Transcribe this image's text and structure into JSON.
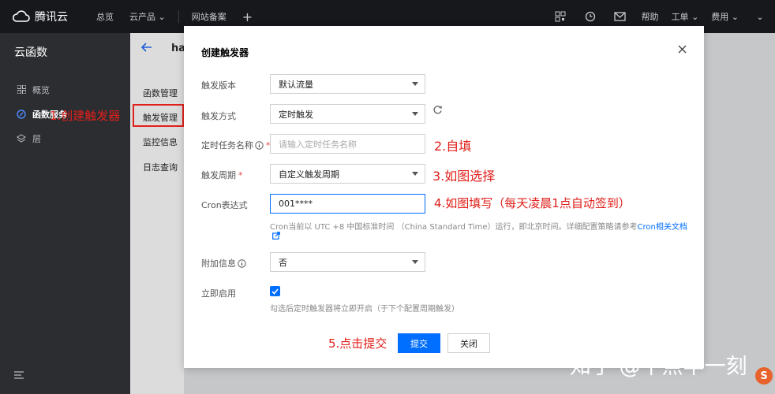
{
  "topbar": {
    "brand": "腾讯云",
    "nav": [
      "总览",
      "云产品",
      "网站备案"
    ],
    "right": [
      "帮助",
      "工单",
      "费用"
    ]
  },
  "sidebar": {
    "title": "云函数",
    "items": [
      {
        "label": "概览",
        "icon": "grid-icon"
      },
      {
        "label": "函数服务",
        "icon": "function-icon"
      },
      {
        "label": "层",
        "icon": "layer-icon"
      }
    ]
  },
  "subside": {
    "page_title_partial": "ha",
    "items": [
      "函数管理",
      "触发管理",
      "监控信息",
      "日志查询"
    ]
  },
  "dialog": {
    "title": "创建触发器",
    "fields": {
      "version": {
        "label": "触发版本",
        "value": "默认流量"
      },
      "method": {
        "label": "触发方式",
        "value": "定时触发"
      },
      "task_name": {
        "label": "定时任务名称",
        "placeholder": "请输入定时任务名称",
        "required": "*"
      },
      "period": {
        "label": "触发周期",
        "value": "自定义触发周期",
        "required": "*"
      },
      "cron": {
        "label": "Cron表达式",
        "value": "001****"
      },
      "cron_hint": {
        "text": "Cron当前以 UTC +8 中国标准时间 （China Standard Time）运行，即北京时间。详细配置策略请参考",
        "link": "Cron相关文档"
      },
      "extra": {
        "label": "附加信息",
        "value": "否"
      },
      "enable": {
        "label": "立即启用",
        "hint": "勾选后定时触发器将立即开启（于下个配置周期触发）"
      }
    },
    "submit_label": "提交",
    "close_label": "关闭"
  },
  "annotations": {
    "a1": "1.创建触发器",
    "a2": "2.自填",
    "a3": "3.如图选择",
    "a4": "4.如图填写（每天凌晨1点自动签到）",
    "a5": "5.点击提交"
  },
  "watermark": "知乎 @十点半一刻",
  "watermark_logo": "S",
  "colors": {
    "accent": "#006eff",
    "annotation": "#e0201b",
    "required": "#e54545"
  }
}
